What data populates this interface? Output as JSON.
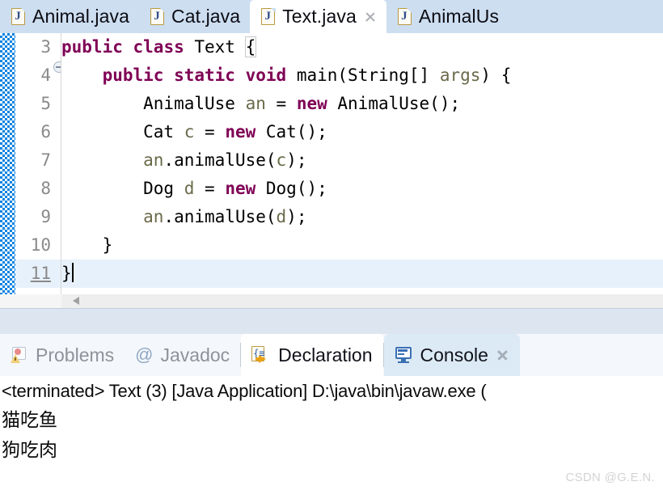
{
  "editor": {
    "tabs": [
      {
        "label": "Animal.java",
        "icon": "java-file-icon",
        "active": false,
        "closable": false
      },
      {
        "label": "Cat.java",
        "icon": "java-file-icon",
        "active": false,
        "closable": false
      },
      {
        "label": "Text.java",
        "icon": "java-file-icon",
        "active": true,
        "closable": true
      },
      {
        "label": "AnimalUs",
        "icon": "java-file-icon",
        "active": false,
        "closable": false
      }
    ],
    "lines": [
      {
        "number": "3",
        "fold": false,
        "current": false,
        "tokens": [
          {
            "t": "public",
            "c": "kw"
          },
          {
            "t": " ",
            "c": "plain"
          },
          {
            "t": "class",
            "c": "kw"
          },
          {
            "t": " Text ",
            "c": "plain"
          },
          {
            "t": "{",
            "c": "brk-match"
          }
        ]
      },
      {
        "number": "4",
        "fold": true,
        "current": false,
        "tokens": [
          {
            "t": "    ",
            "c": "plain"
          },
          {
            "t": "public",
            "c": "kw"
          },
          {
            "t": " ",
            "c": "plain"
          },
          {
            "t": "static",
            "c": "kw"
          },
          {
            "t": " ",
            "c": "plain"
          },
          {
            "t": "void",
            "c": "kw"
          },
          {
            "t": " main(String[] ",
            "c": "plain"
          },
          {
            "t": "args",
            "c": "var"
          },
          {
            "t": ") {",
            "c": "plain"
          }
        ]
      },
      {
        "number": "5",
        "fold": false,
        "current": false,
        "tokens": [
          {
            "t": "        AnimalUse ",
            "c": "plain"
          },
          {
            "t": "an",
            "c": "var"
          },
          {
            "t": " = ",
            "c": "plain"
          },
          {
            "t": "new",
            "c": "kw"
          },
          {
            "t": " AnimalUse();",
            "c": "plain"
          }
        ]
      },
      {
        "number": "6",
        "fold": false,
        "current": false,
        "tokens": [
          {
            "t": "        Cat ",
            "c": "plain"
          },
          {
            "t": "c",
            "c": "var"
          },
          {
            "t": " = ",
            "c": "plain"
          },
          {
            "t": "new",
            "c": "kw"
          },
          {
            "t": " Cat();",
            "c": "plain"
          }
        ]
      },
      {
        "number": "7",
        "fold": false,
        "current": false,
        "tokens": [
          {
            "t": "        ",
            "c": "plain"
          },
          {
            "t": "an",
            "c": "var"
          },
          {
            "t": ".animalUse(",
            "c": "plain"
          },
          {
            "t": "c",
            "c": "var"
          },
          {
            "t": ");",
            "c": "plain"
          }
        ]
      },
      {
        "number": "8",
        "fold": false,
        "current": false,
        "tokens": [
          {
            "t": "        Dog ",
            "c": "plain"
          },
          {
            "t": "d",
            "c": "var"
          },
          {
            "t": " = ",
            "c": "plain"
          },
          {
            "t": "new",
            "c": "kw"
          },
          {
            "t": " Dog();",
            "c": "plain"
          }
        ]
      },
      {
        "number": "9",
        "fold": false,
        "current": false,
        "tokens": [
          {
            "t": "        ",
            "c": "plain"
          },
          {
            "t": "an",
            "c": "var"
          },
          {
            "t": ".animalUse(",
            "c": "plain"
          },
          {
            "t": "d",
            "c": "var"
          },
          {
            "t": ");",
            "c": "plain"
          }
        ]
      },
      {
        "number": "10",
        "fold": false,
        "current": false,
        "tokens": [
          {
            "t": "    }",
            "c": "plain"
          }
        ]
      },
      {
        "number": "11",
        "fold": false,
        "current": true,
        "caret": true,
        "tokens": [
          {
            "t": "}",
            "c": "plain"
          }
        ]
      }
    ],
    "scrollbar": {
      "left_arrow_icon": "triangle-left-icon"
    }
  },
  "view_tabs": [
    {
      "label": "Problems",
      "icon": "problems-icon",
      "state": "inactive-dim",
      "closable": false
    },
    {
      "label": "Javadoc",
      "icon": "at-sign-icon",
      "state": "inactive-dim",
      "closable": false
    },
    {
      "label": "Declaration",
      "icon": "declaration-icon",
      "state": "selected-white",
      "closable": false
    },
    {
      "label": "Console",
      "icon": "console-icon",
      "state": "selected-blue",
      "closable": true
    }
  ],
  "console": {
    "header": "<terminated> Text (3) [Java Application] D:\\java\\bin\\javaw.exe (",
    "output": [
      "猫吃鱼",
      "狗吃肉"
    ]
  },
  "watermark": "CSDN @G.E.N.",
  "colors": {
    "tabbar_bg": "#cddef0",
    "active_tab_bg": "#ffffff",
    "keyword": "#7f0055",
    "variable": "#6a6a4a",
    "line_number": "#8a8a8a",
    "current_line_bg": "#e7f1fb",
    "change_marker": "#0a83e0",
    "console_tab_bg": "#dceaf5",
    "sash_bg": "#dde5f1"
  }
}
